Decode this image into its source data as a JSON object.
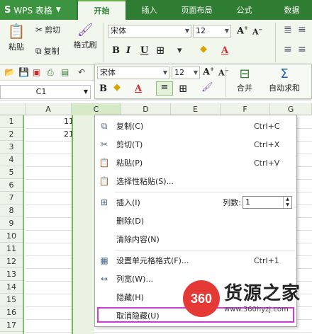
{
  "titlebar": {
    "app_name": "WPS 表格",
    "logo": "S"
  },
  "tabs": [
    "开始",
    "插入",
    "页面布局",
    "公式",
    "数据"
  ],
  "ribbon": {
    "paste": "粘贴",
    "cut": "剪切",
    "copy": "复制",
    "format_painter": "格式刷",
    "font_name": "宋体",
    "font_size": "12"
  },
  "mini_toolbar": {
    "font_name": "宋体",
    "font_size": "12",
    "merge": "合并",
    "autosum": "自动求和"
  },
  "namebox": "C1",
  "columns": [
    "A",
    "C",
    "D",
    "E",
    "F",
    "G"
  ],
  "rows": [
    "1",
    "2",
    "3",
    "4",
    "5",
    "6",
    "7",
    "8",
    "9",
    "10",
    "11",
    "12",
    "13",
    "14",
    "15",
    "16",
    "17"
  ],
  "cells": {
    "A1": "11",
    "A2": "21"
  },
  "context_menu": {
    "items": [
      {
        "label": "复制(C)",
        "shortcut": "Ctrl+C",
        "icon": "copy-icon"
      },
      {
        "label": "剪切(T)",
        "shortcut": "Ctrl+X",
        "icon": "scissors-icon"
      },
      {
        "label": "粘贴(P)",
        "shortcut": "Ctrl+V",
        "icon": "paste-icon"
      },
      {
        "label": "选择性粘贴(S)...",
        "shortcut": "",
        "icon": "paste-special-icon"
      },
      {
        "label": "插入(I)",
        "shortcut": "",
        "icon": "insert-icon"
      },
      {
        "label": "删除(D)",
        "shortcut": "",
        "icon": ""
      },
      {
        "label": "清除内容(N)",
        "shortcut": "",
        "icon": ""
      },
      {
        "label": "设置单元格格式(F)...",
        "shortcut": "Ctrl+1",
        "icon": "format-cells-icon"
      },
      {
        "label": "列宽(W)...",
        "shortcut": "",
        "icon": "column-width-icon"
      },
      {
        "label": "隐藏(H)",
        "shortcut": "",
        "icon": ""
      },
      {
        "label": "取消隐藏(U)",
        "shortcut": "",
        "icon": ""
      }
    ],
    "column_count_label": "列数:",
    "column_count_value": "1"
  },
  "watermark": {
    "badge": "360",
    "name": "货源之家",
    "url": "www.360hyzj.com"
  },
  "colors": {
    "title_green": "#2f7d33",
    "selection_green": "#6cbb55",
    "highlight_purple": "#cc3bd8",
    "logo_red": "#e53935"
  }
}
